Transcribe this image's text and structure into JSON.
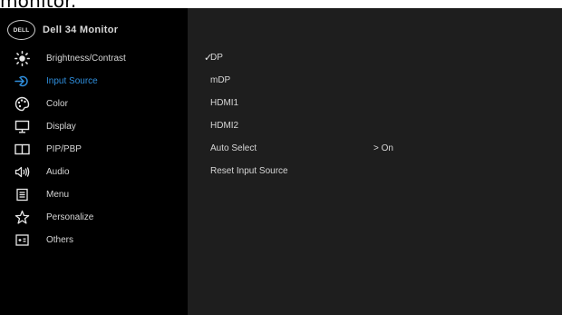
{
  "page_heading": "monitor.",
  "brand": {
    "logo_text": "DELL",
    "model": "Dell 34 Monitor"
  },
  "menu": [
    {
      "label": "Brightness/Contrast",
      "icon": "brightness-icon"
    },
    {
      "label": "Input Source",
      "icon": "input-source-icon",
      "active": true
    },
    {
      "label": "Color",
      "icon": "color-palette-icon"
    },
    {
      "label": "Display",
      "icon": "display-icon"
    },
    {
      "label": "PIP/PBP",
      "icon": "pip-pbp-icon"
    },
    {
      "label": "Audio",
      "icon": "audio-icon"
    },
    {
      "label": "Menu",
      "icon": "menu-icon"
    },
    {
      "label": "Personalize",
      "icon": "star-icon"
    },
    {
      "label": "Others",
      "icon": "others-icon"
    }
  ],
  "options": [
    {
      "label": "DP",
      "checked": true,
      "check_glyph": "✓"
    },
    {
      "label": "mDP"
    },
    {
      "label": "HDMI1"
    },
    {
      "label": "HDMI2"
    },
    {
      "label": "Auto Select",
      "value": "> On"
    },
    {
      "label": "Reset Input Source"
    }
  ],
  "colors": {
    "accent": "#2f8fde",
    "panel": "#1e1e1e",
    "sidebar": "#000000",
    "text": "#d6d6d6"
  }
}
